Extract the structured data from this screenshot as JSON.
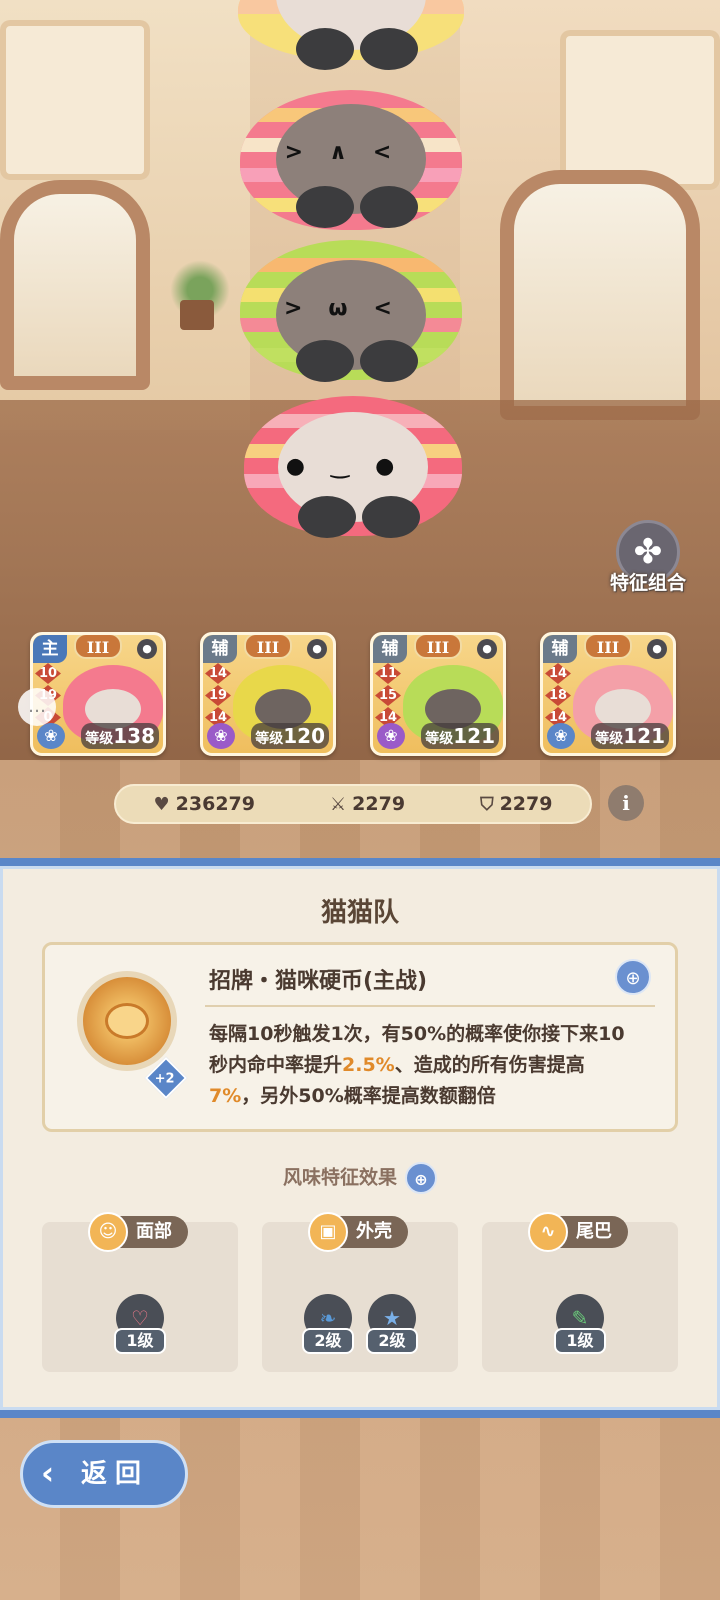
{
  "feature_combo": {
    "label": "特征组合",
    "icon": "clover-icon"
  },
  "team": [
    {
      "role": "主",
      "tier": "III",
      "stats": [
        "10",
        "19",
        "0"
      ],
      "level_prefix": "等级",
      "level": "138",
      "paw_color": "#5a86c8"
    },
    {
      "role": "辅",
      "tier": "III",
      "stats": [
        "14",
        "19",
        "14"
      ],
      "level_prefix": "等级",
      "level": "120",
      "paw_color": "#9a5ac8"
    },
    {
      "role": "辅",
      "tier": "III",
      "stats": [
        "11",
        "15",
        "14"
      ],
      "level_prefix": "等级",
      "level": "121",
      "paw_color": "#9a5ac8"
    },
    {
      "role": "辅",
      "tier": "III",
      "stats": [
        "14",
        "18",
        "14"
      ],
      "level_prefix": "等级",
      "level": "121",
      "paw_color": "#5a86c8"
    }
  ],
  "stats_bar": {
    "hp": "236279",
    "attack": "2279",
    "defense": "2279"
  },
  "panel": {
    "title": "猫猫队",
    "skill": {
      "name": "招牌・猫咪硬币(主战)",
      "badge": "+2",
      "desc_parts": [
        "每隔10秒触发1次，有50%的概率使你接下来10秒内命中率提升",
        "2.5%",
        "、造成的所有伤害提高",
        "7%",
        "，另外50%概率提高数额翻倍"
      ]
    },
    "flavor_title": "风味特征效果",
    "traits": [
      {
        "name": "面部",
        "gems": [
          {
            "icon": "heart-icon",
            "level": "1级"
          }
        ]
      },
      {
        "name": "外壳",
        "gems": [
          {
            "icon": "feather-icon",
            "level": "2级"
          },
          {
            "icon": "star-shield-icon",
            "level": "2级"
          }
        ]
      },
      {
        "name": "尾巴",
        "gems": [
          {
            "icon": "leaf-icon",
            "level": "1级"
          }
        ]
      }
    ]
  },
  "back_button": {
    "label": "返回"
  },
  "colors": {
    "accent": "#5a86c8",
    "highlight": "#e08a2a",
    "panel_bg": "#f3ece0"
  }
}
